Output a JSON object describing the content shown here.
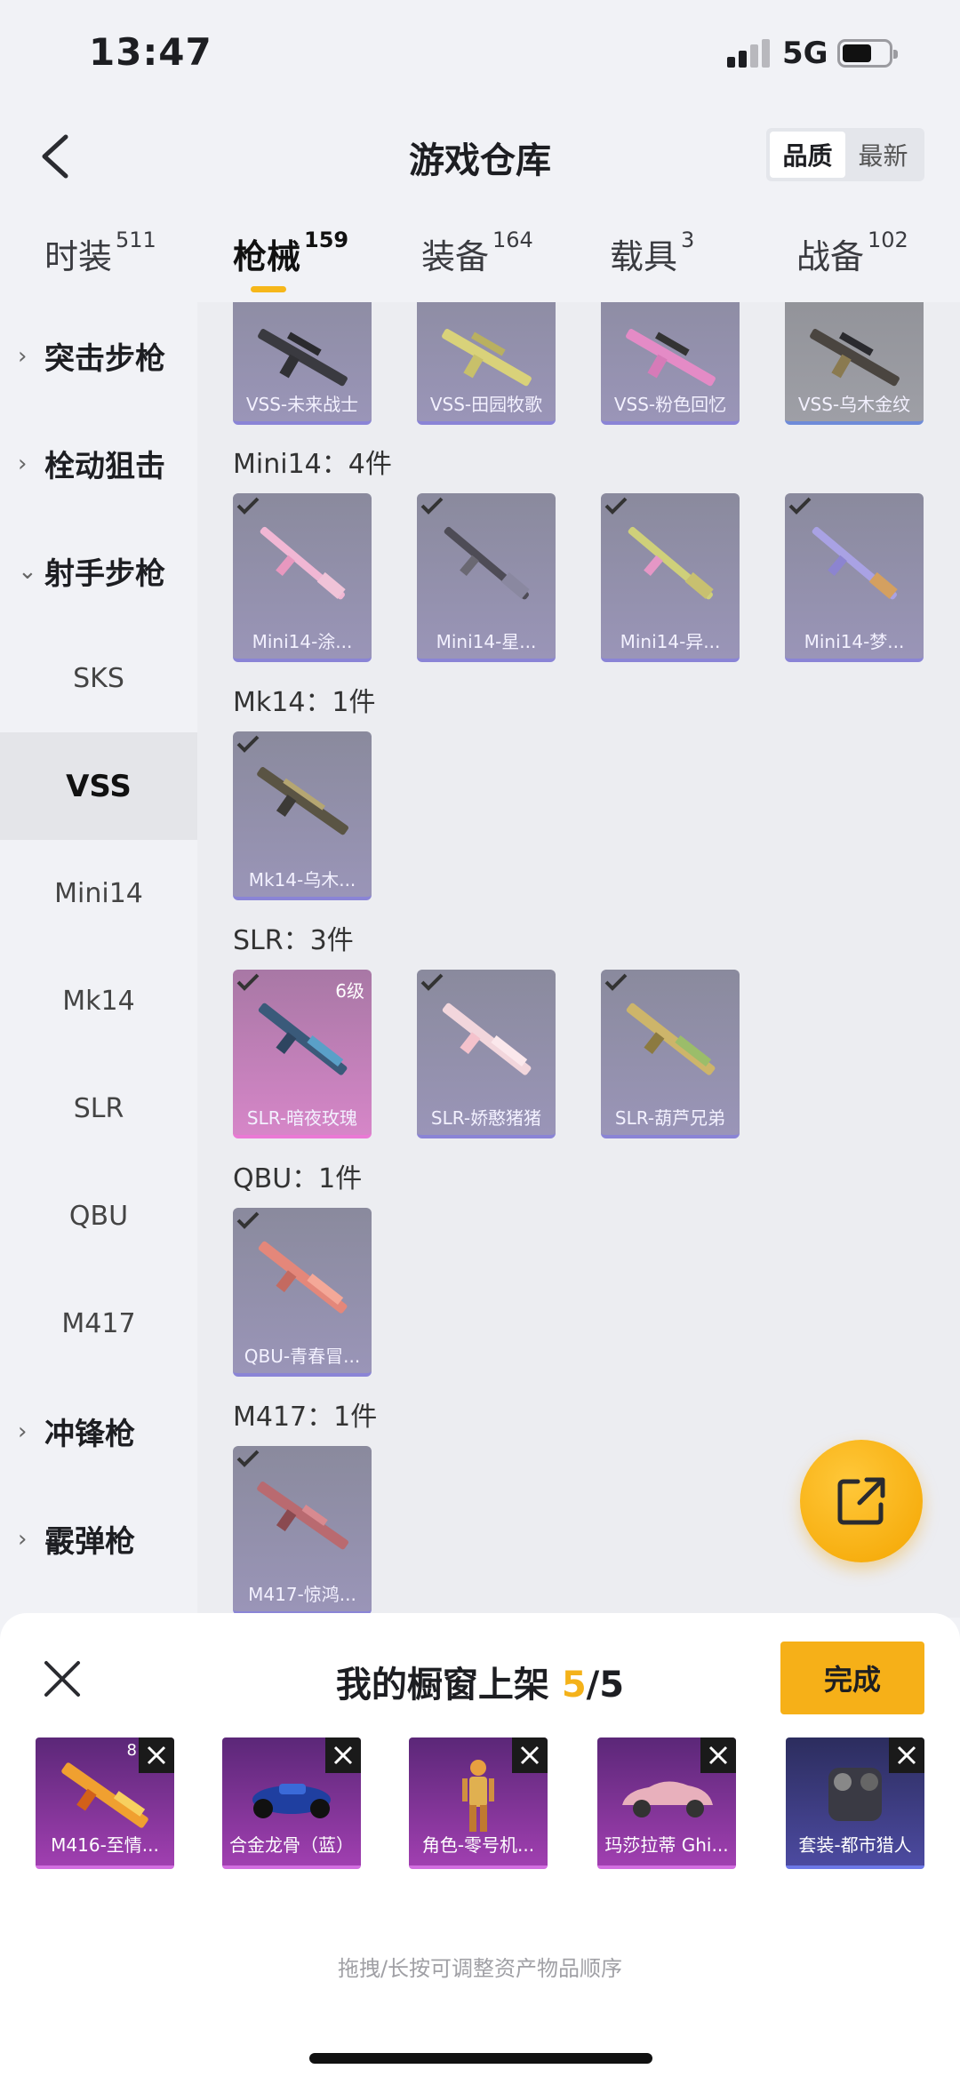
{
  "status": {
    "time": "13:47",
    "network": "5G"
  },
  "header": {
    "title": "游戏仓库",
    "sort_options": [
      "品质",
      "最新"
    ]
  },
  "tabs": [
    {
      "label": "时装",
      "count": "511"
    },
    {
      "label": "枪械",
      "count": "159"
    },
    {
      "label": "装备",
      "count": "164"
    },
    {
      "label": "载具",
      "count": "3"
    },
    {
      "label": "战备",
      "count": "102"
    }
  ],
  "sidebar": [
    {
      "label": "突击步枪",
      "type": "group"
    },
    {
      "label": "栓动狙击",
      "type": "group"
    },
    {
      "label": "射手步枪",
      "type": "group"
    },
    {
      "label": "SKS",
      "type": "sub"
    },
    {
      "label": "VSS",
      "type": "sub",
      "selected": true
    },
    {
      "label": "Mini14",
      "type": "sub"
    },
    {
      "label": "Mk14",
      "type": "sub"
    },
    {
      "label": "SLR",
      "type": "sub"
    },
    {
      "label": "QBU",
      "type": "sub"
    },
    {
      "label": "M417",
      "type": "sub"
    },
    {
      "label": "冲锋枪",
      "type": "group"
    },
    {
      "label": "霰弹枪",
      "type": "group"
    }
  ],
  "vss_items": [
    "VSS-未来战士",
    "VSS-田园牧歌",
    "VSS-粉色回忆",
    "VSS-乌木金纹"
  ],
  "sections": [
    {
      "title": "Mini14：4件",
      "items": [
        "Mini14-涂...",
        "Mini14-星...",
        "Mini14-异...",
        "Mini14-梦..."
      ]
    },
    {
      "title": "Mk14：1件",
      "items": [
        "Mk14-乌木..."
      ]
    },
    {
      "title": "SLR：3件",
      "items": [
        "SLR-暗夜玫瑰",
        "SLR-娇憨猪猪",
        "SLR-葫芦兄弟"
      ],
      "level_badge": "6级"
    },
    {
      "title": "QBU：1件",
      "items": [
        "QBU-青春冒..."
      ]
    },
    {
      "title": "M417：1件",
      "items": [
        "M417-惊鸿..."
      ]
    }
  ],
  "sheet": {
    "title_prefix": "我的橱窗上架 ",
    "count": "5",
    "total": "/5",
    "done_label": "完成",
    "items": [
      "M416-至情...",
      "合金龙骨（蓝）",
      "角色-零号机...",
      "玛莎拉蒂 Ghi...",
      "套装-都市猎人"
    ],
    "first_item_badge": "8",
    "hint": "拖拽/长按可调整资产物品顺序"
  },
  "colors": {
    "accent": "#f6b018",
    "selected_bg": "#e4e5e9"
  }
}
